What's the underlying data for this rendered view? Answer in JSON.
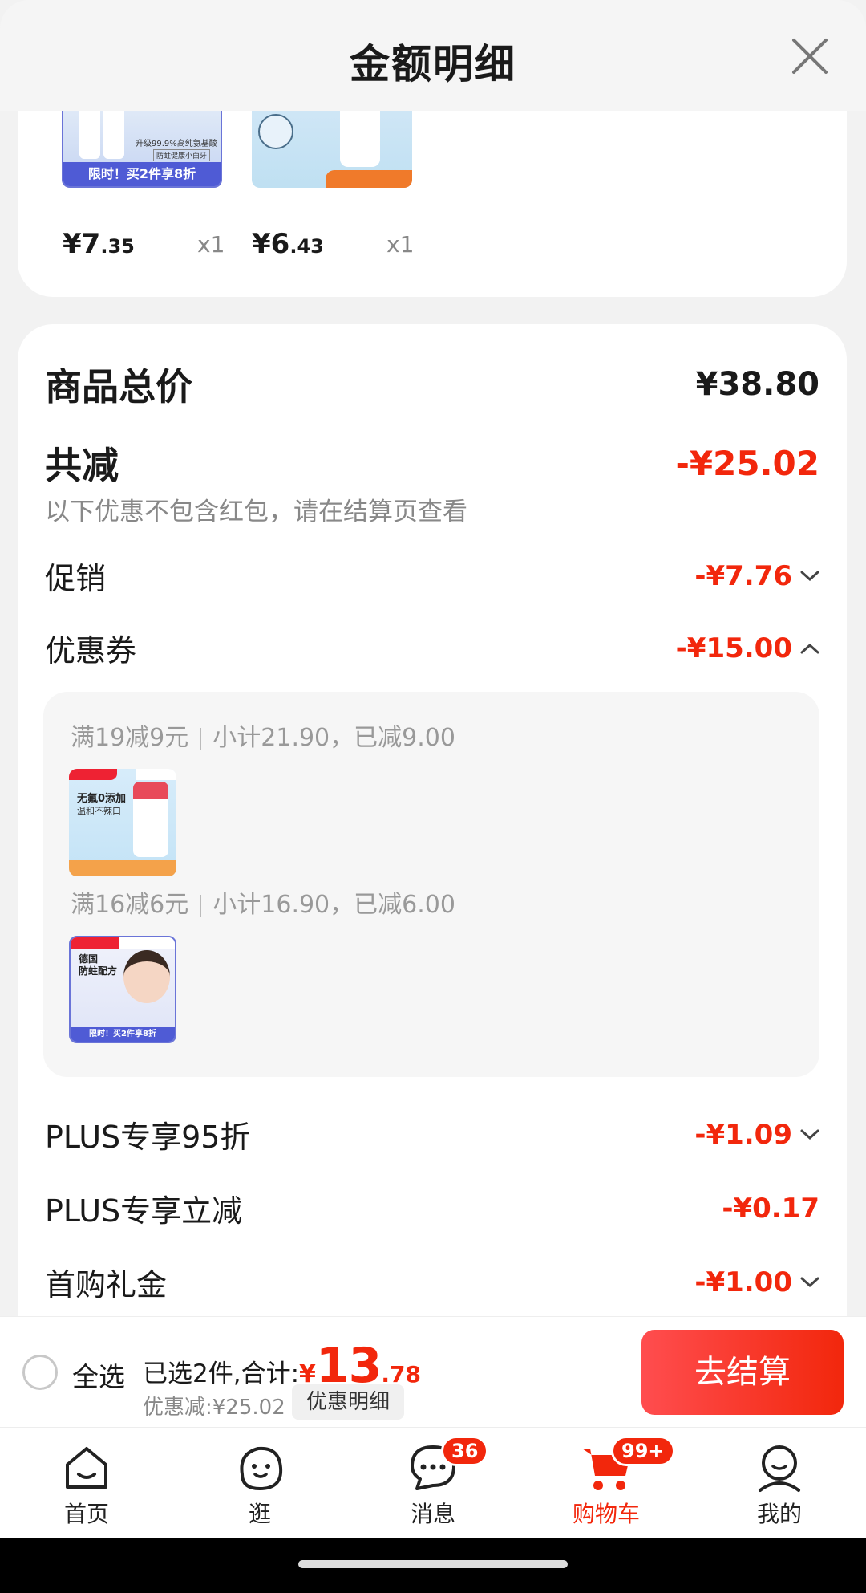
{
  "header": {
    "title": "金额明细",
    "close_icon": "close-icon"
  },
  "products": [
    {
      "price_int": "¥7",
      "price_dec": ".35",
      "qty": "x1",
      "promo": "限时！买2件享8折",
      "tagline": "升级99.9%高纯氨基酸",
      "tagline2": "防蛀健康小白牙"
    },
    {
      "price_int": "¥6",
      "price_dec": ".43",
      "qty": "x1"
    }
  ],
  "summary": {
    "total_label": "商品总价",
    "total_value": "¥38.80",
    "reduce_label": "共减",
    "reduce_value": "-¥25.02",
    "note": "以下优惠不包含红包，请在结算页查看",
    "promo_label": "促销",
    "promo_value": "-¥7.76",
    "coupon_label": "优惠券",
    "coupon_value": "-¥15.00",
    "plus95_label": "PLUS专享95折",
    "plus95_value": "-¥1.09",
    "plus_reduce_label": "PLUS专享立减",
    "plus_reduce_value": "-¥0.17",
    "first_buy_label": "首购礼金",
    "first_buy_value": "-¥1.00"
  },
  "coupons": [
    {
      "rule": "满19减9元",
      "subtotal": "小计21.90，已减9.00",
      "thumb_t1": "无氟0添加",
      "thumb_t2": "温和不辣口"
    },
    {
      "rule": "满16减6元",
      "subtotal": "小计16.90，已减6.00",
      "thumb_t1": "德国",
      "thumb_t2": "防蛀配方",
      "thumb_bar": "限时！买2件享8折"
    }
  ],
  "checkout": {
    "select_all": "全选",
    "selected_prefix": "已选2件,合计:",
    "yen": "¥",
    "total_int": "13",
    "total_dec": ".78",
    "discount": "优惠减:¥25.02",
    "detail_button": "优惠明细",
    "checkout_button": "去结算"
  },
  "tabs": [
    {
      "label": "首页",
      "icon": "home-icon"
    },
    {
      "label": "逛",
      "icon": "explore-icon"
    },
    {
      "label": "消息",
      "icon": "message-icon",
      "badge": "36"
    },
    {
      "label": "购物车",
      "icon": "cart-icon",
      "badge": "99+",
      "active": true
    },
    {
      "label": "我的",
      "icon": "profile-icon"
    }
  ],
  "colors": {
    "accent": "#f2270c",
    "background": "#f2f2f2"
  }
}
